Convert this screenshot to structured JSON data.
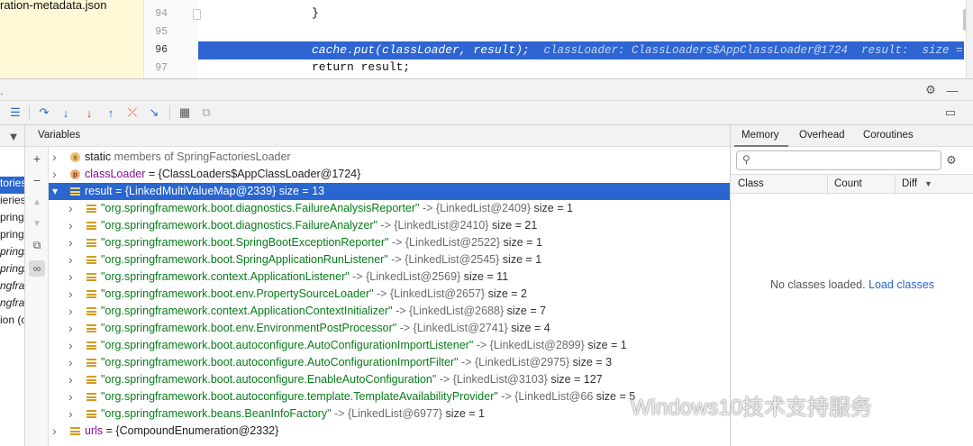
{
  "editor": {
    "project_file": "ration-metadata.json",
    "line_numbers": [
      "94",
      "95",
      "96",
      "97"
    ],
    "lines": [
      "}",
      "",
      "cache.put(classLoader, result);",
      "return result;"
    ],
    "inline_hint": "classLoader: ClassLoaders$AppClassLoader@1724  result:  size ="
  },
  "frames": [
    "toriesL",
    "ieriesL",
    "pringA",
    "pringA",
    "pring/",
    "pring/",
    "ngfra",
    "ngfra",
    "ion  (c"
  ],
  "variables": {
    "title": "Variables",
    "rows": [
      {
        "kind": "static",
        "name": "static",
        "rest": " members of SpringFactoriesLoader",
        "depth": 0
      },
      {
        "kind": "param",
        "name": "classLoader",
        "rest": " = {ClassLoaders$AppClassLoader@1724}",
        "depth": 0
      },
      {
        "kind": "list",
        "name": "result",
        "rest": " = {LinkedMultiValueMap@2339}  size = 13",
        "depth": 0,
        "expanded": true,
        "selected": true
      },
      {
        "kind": "entry",
        "key": "\"org.springframework.boot.diagnostics.FailureAnalysisReporter\"",
        "val": " -> {LinkedList@2409}",
        "size": "  size = 1"
      },
      {
        "kind": "entry",
        "key": "\"org.springframework.boot.diagnostics.FailureAnalyzer\"",
        "val": " -> {LinkedList@2410}",
        "size": "  size = 21"
      },
      {
        "kind": "entry",
        "key": "\"org.springframework.boot.SpringBootExceptionReporter\"",
        "val": " -> {LinkedList@2522}",
        "size": "  size = 1"
      },
      {
        "kind": "entry",
        "key": "\"org.springframework.boot.SpringApplicationRunListener\"",
        "val": " -> {LinkedList@2545}",
        "size": "  size = 1"
      },
      {
        "kind": "entry",
        "key": "\"org.springframework.context.ApplicationListener\"",
        "val": " -> {LinkedList@2569}",
        "size": "  size = 11"
      },
      {
        "kind": "entry",
        "key": "\"org.springframework.boot.env.PropertySourceLoader\"",
        "val": " -> {LinkedList@2657}",
        "size": "  size = 2"
      },
      {
        "kind": "entry",
        "key": "\"org.springframework.context.ApplicationContextInitializer\"",
        "val": " -> {LinkedList@2688}",
        "size": "  size = 7"
      },
      {
        "kind": "entry",
        "key": "\"org.springframework.boot.env.EnvironmentPostProcessor\"",
        "val": " -> {LinkedList@2741}",
        "size": "  size = 4"
      },
      {
        "kind": "entry",
        "key": "\"org.springframework.boot.autoconfigure.AutoConfigurationImportListener\"",
        "val": " -> {LinkedList@2899}",
        "size": "  size = 1"
      },
      {
        "kind": "entry",
        "key": "\"org.springframework.boot.autoconfigure.AutoConfigurationImportFilter\"",
        "val": " -> {LinkedList@2975}",
        "size": "  size = 3"
      },
      {
        "kind": "entry",
        "key": "\"org.springframework.boot.autoconfigure.EnableAutoConfiguration\"",
        "val": " -> {LinkedList@3103}",
        "size": "  size = 127"
      },
      {
        "kind": "entry",
        "key": "\"org.springframework.boot.autoconfigure.template.TemplateAvailabilityProvider\"",
        "val": " -> {LinkedList@66",
        "size": "  size = 5"
      },
      {
        "kind": "entry",
        "key": "\"org.springframework.beans.BeanInfoFactory\"",
        "val": " -> {LinkedList@6977}",
        "size": "  size = 1"
      },
      {
        "kind": "list",
        "name": "urls",
        "rest": " = {CompoundEnumeration@2332}",
        "depth": 0
      }
    ]
  },
  "memory": {
    "tabs": [
      "Memory",
      "Overhead",
      "Coroutines"
    ],
    "columns": [
      "Class",
      "Count",
      "Diff"
    ],
    "empty_text": "No classes loaded.",
    "load_link": "Load classes"
  },
  "watermark": "Windows10技术支持服务",
  "colors": {
    "selection": "#2a66cf",
    "string": "#067d17",
    "exec_line": "#2e65d2"
  }
}
